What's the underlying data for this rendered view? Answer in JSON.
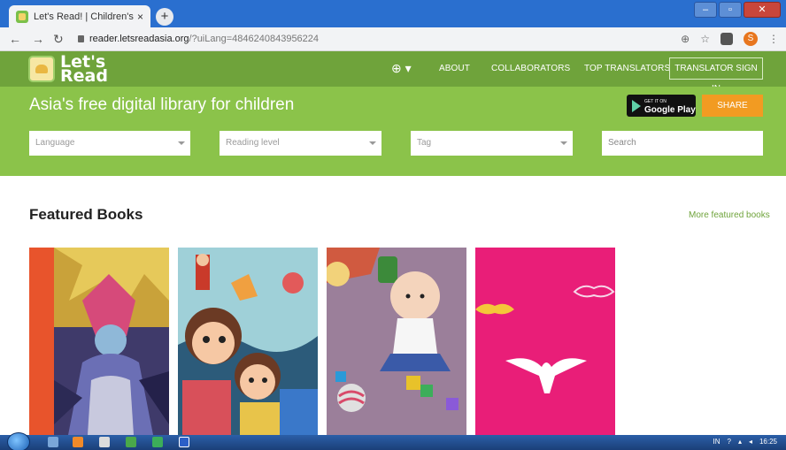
{
  "browser": {
    "tab_title": "Let's Read! | Children's Books | F",
    "tab_close": "×",
    "new_tab": "+",
    "url_host": "reader.letsreadasia.org",
    "url_path": "/?uiLang=4846240843956224",
    "profile_initial": "S"
  },
  "site": {
    "logo_line1": "Let's",
    "logo_line2": "Read",
    "nav": {
      "about": "ABOUT",
      "collaborators": "COLLABORATORS",
      "top_translators": "TOP TRANSLATORS",
      "sign_in": "TRANSLATOR SIGN IN"
    }
  },
  "hero": {
    "tagline": "Asia's free digital library for children",
    "gplay_small": "GET IT ON",
    "gplay_big": "Google Play",
    "share": "SHARE",
    "filters": {
      "language": "Language",
      "reading_level": "Reading level",
      "tag": "Tag",
      "search_placeholder": "Search"
    }
  },
  "featured": {
    "title": "Featured Books",
    "more_link": "More featured books"
  },
  "taskbar": {
    "lang": "IN",
    "clock": "16:25"
  },
  "colors": {
    "header_green": "#6fa33b",
    "hero_green": "#8bc34a",
    "share_orange": "#f29b22"
  }
}
